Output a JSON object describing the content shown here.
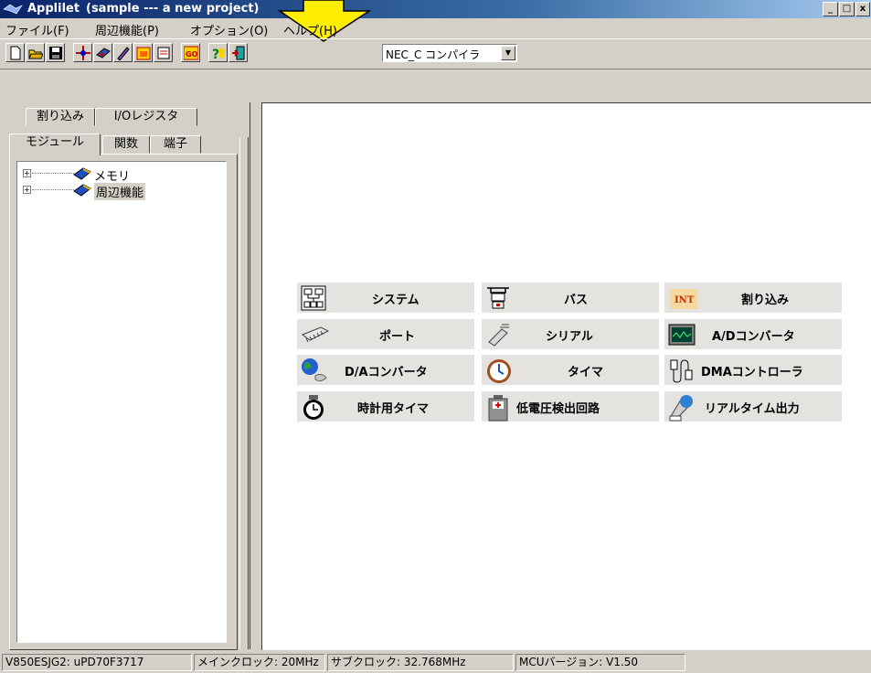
{
  "window": {
    "title": "Applilet",
    "project": "(sample --- a new project)",
    "controls": [
      "_",
      "□",
      "x"
    ]
  },
  "menu": [
    "ファイル(F)",
    "周辺機能(P)",
    "オプション(O)",
    "ヘルプ(H)"
  ],
  "toolbar": {
    "buttons": [
      "new-file-icon",
      "open-folder-icon",
      "save-icon",
      "crosshair-icon",
      "chip-icon",
      "pen-icon",
      "calendar-icon",
      "note-icon",
      "go-icon",
      "help-icon",
      "exit-icon"
    ],
    "compiler_value": "NEC_C コンパイラ",
    "compiler_arrow": "▼"
  },
  "tabs": {
    "row1": [
      "割り込み",
      "I/Oレジスタ"
    ],
    "row2": [
      "モジュール",
      "関数",
      "端子"
    ]
  },
  "tree": [
    {
      "label": "メモリ",
      "expander": "+"
    },
    {
      "label": "周辺機能",
      "expander": "+"
    }
  ],
  "functions": [
    {
      "label": "システム",
      "icon": "system-icon"
    },
    {
      "label": "バス",
      "icon": "bus-icon"
    },
    {
      "label": "割り込み",
      "icon": "interrupt-icon",
      "icon_text": "INT"
    },
    {
      "label": "ポート",
      "icon": "port-icon"
    },
    {
      "label": "シリアル",
      "icon": "serial-icon"
    },
    {
      "label": "A/Dコンバータ",
      "icon": "adc-icon"
    },
    {
      "label": "D/Aコンバータ",
      "icon": "dac-icon"
    },
    {
      "label": "タイマ",
      "icon": "timer-icon"
    },
    {
      "label": "DMAコントローラ",
      "icon": "dma-icon"
    },
    {
      "label": "時計用タイマ",
      "icon": "watch-timer-icon"
    },
    {
      "label": "低電圧検出回路",
      "icon": "low-voltage-icon"
    },
    {
      "label": "リアルタイム出力",
      "icon": "realtime-output-icon"
    }
  ],
  "status": [
    "V850ESJG2: uPD70F3717",
    "メインクロック: 20MHz",
    "サブクロック: 32.768MHz",
    "MCUバージョン:  V1.50"
  ],
  "colors": {
    "titlebar": "#0a246a",
    "face": "#d4d0c8",
    "pointer_arrow": "#ffee00"
  }
}
